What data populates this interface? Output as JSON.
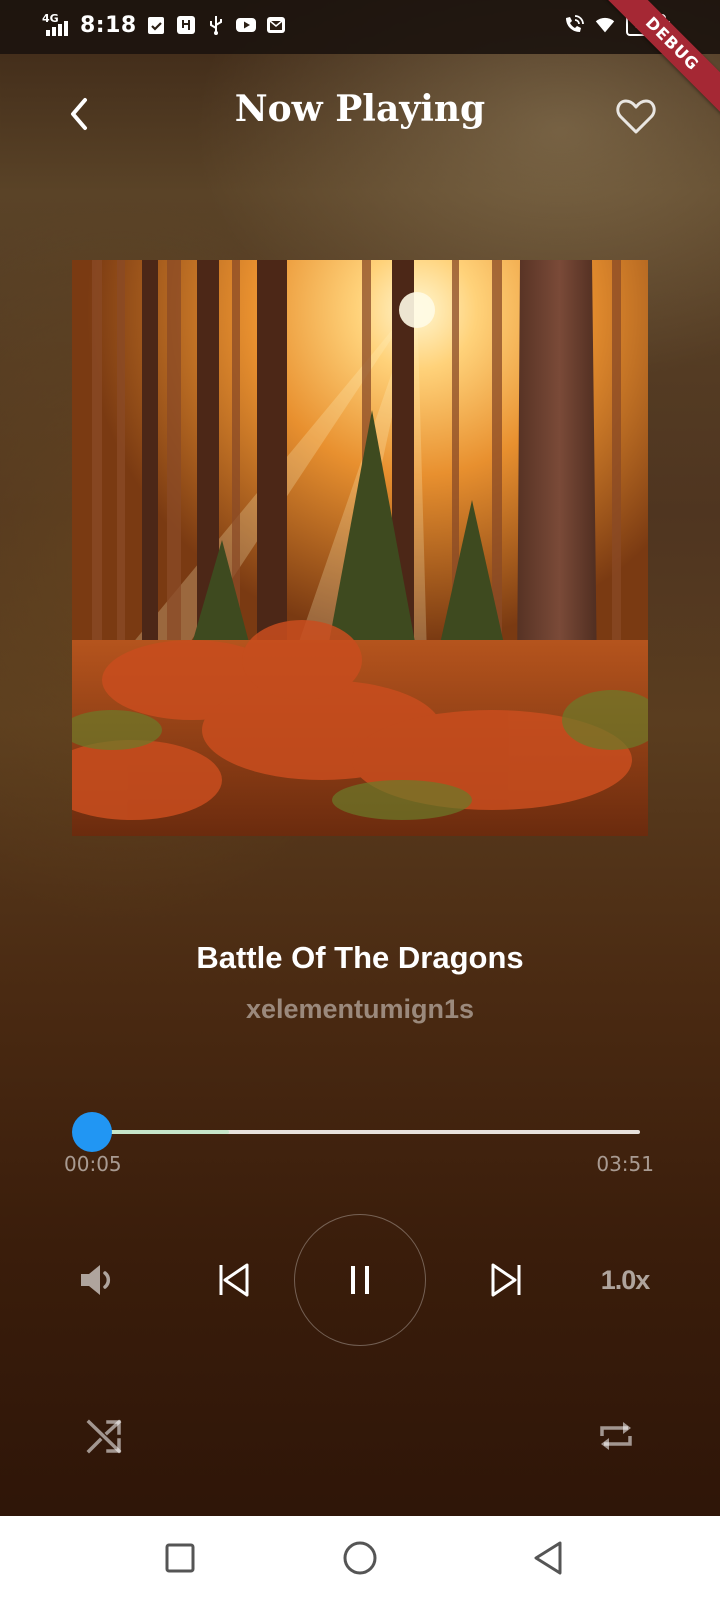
{
  "status_bar": {
    "network": "4G",
    "time": "8:18",
    "battery": "100",
    "icons": [
      "signal-icon",
      "clipboard-check-icon",
      "usb-debug-icon",
      "usb-icon",
      "youtube-icon",
      "mail-icon",
      "wifi-calling-icon",
      "wifi-icon",
      "battery-icon"
    ]
  },
  "debug_banner": "DEBUG",
  "header": {
    "title": "Now Playing",
    "back_icon": "chevron-left-icon",
    "favorite_icon": "heart-outline-icon"
  },
  "album_art": {
    "description_icon": "album-art-image"
  },
  "song": {
    "title": "Battle Of The Dragons",
    "artist": "xelementumign1s"
  },
  "progress": {
    "current": "00:05",
    "total": "03:51",
    "played_fraction": 0.0,
    "buffered_fraction": 0.25
  },
  "controls": {
    "volume_icon": "volume-icon",
    "previous_icon": "skip-previous-icon",
    "pause_icon": "pause-icon",
    "next_icon": "skip-next-icon",
    "speed": "1.0x",
    "shuffle_icon": "shuffle-icon",
    "repeat_icon": "repeat-icon"
  },
  "colors": {
    "accent": "#2196f3",
    "buffer": "#c7e6c9",
    "debug_ribbon": "#a52834"
  },
  "nav_bar": {
    "icons": [
      "recents-square-icon",
      "home-circle-icon",
      "back-triangle-icon"
    ]
  }
}
